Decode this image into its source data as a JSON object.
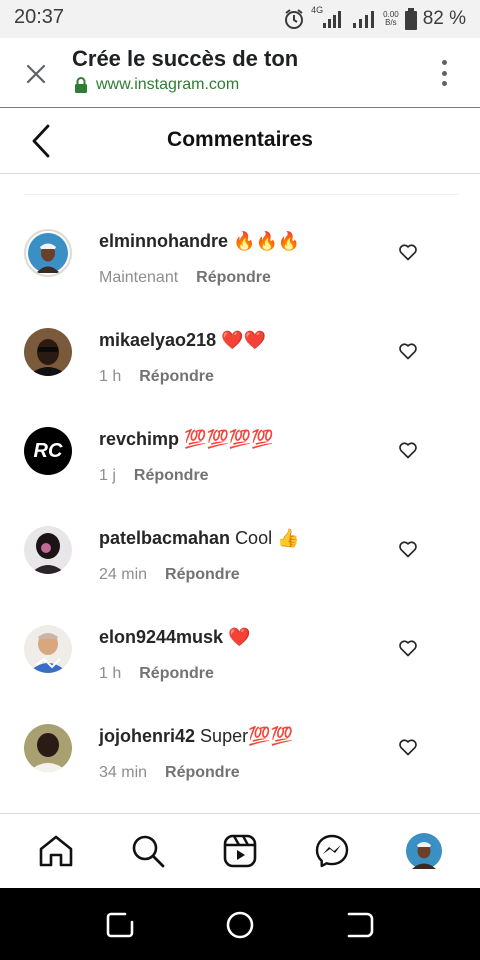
{
  "status_bar": {
    "time": "20:37",
    "network_type": "4G",
    "speed_value": "0.00",
    "speed_unit": "B/s",
    "battery": "82 %"
  },
  "browser": {
    "title": "Crée le succès de ton",
    "url": "www.instagram.com"
  },
  "header": {
    "title": "Commentaires"
  },
  "comments": [
    {
      "username": "elminnohandre",
      "text": "🔥🔥🔥",
      "time": "Maintenant",
      "reply": "Répondre"
    },
    {
      "username": "mikaelyao218",
      "text": "❤️❤️",
      "time": "1 h",
      "reply": "Répondre"
    },
    {
      "username": "revchimp",
      "text": "💯💯💯💯",
      "time": "1 j",
      "reply": "Répondre"
    },
    {
      "username": "patelbacmahan",
      "text": "Cool 👍",
      "time": "24 min",
      "reply": "Répondre"
    },
    {
      "username": "elon9244musk",
      "text": "❤️",
      "time": "1 h",
      "reply": "Répondre"
    },
    {
      "username": "jojohenri42",
      "text": "Super💯💯",
      "time": "34 min",
      "reply": "Répondre"
    }
  ],
  "avatar_badge_text": "RC",
  "bottom_nav": [
    "home-icon",
    "search-icon",
    "reels-icon",
    "messenger-icon",
    "profile-avatar"
  ],
  "colors": {
    "url_green": "#2e7d32",
    "muted_text": "#8e8e8e",
    "accent_text": "#262626"
  }
}
